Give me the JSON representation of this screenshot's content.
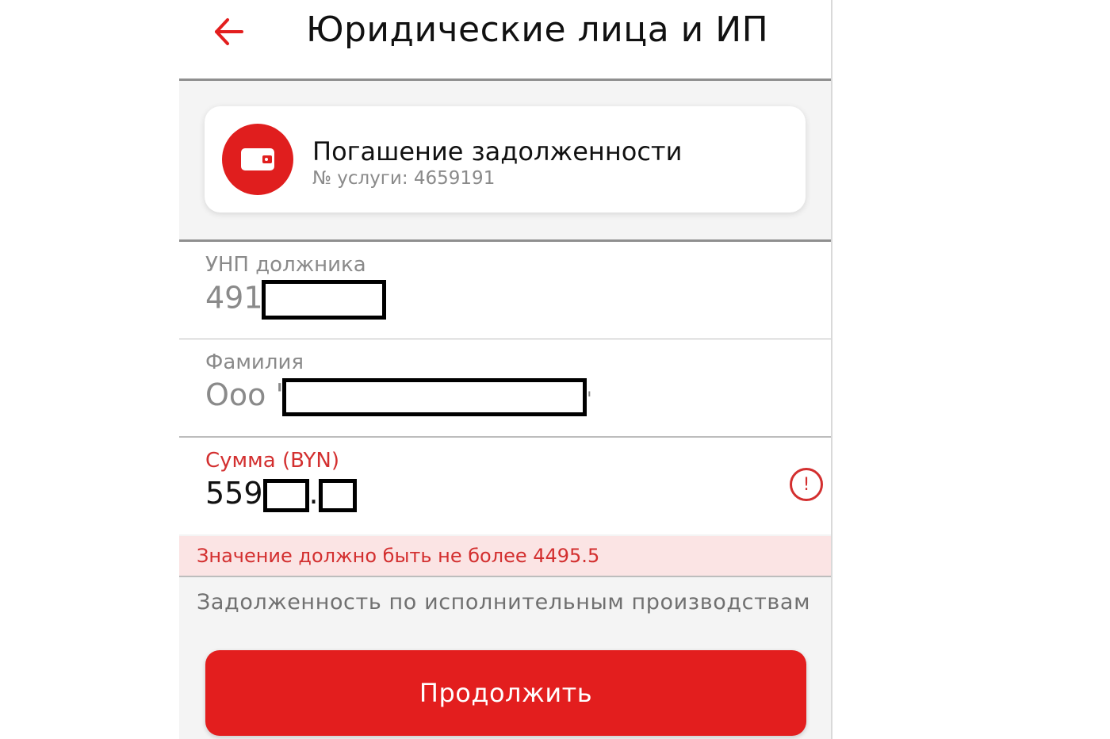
{
  "header": {
    "title": "Юридические лица и ИП",
    "back_icon": "arrow-left-icon"
  },
  "service": {
    "icon": "wallet-icon",
    "title": "Погашение задолженности",
    "subtitle": "№ услуги: 4659191"
  },
  "fields": {
    "unp": {
      "label": "УНП должника",
      "value_prefix": "491"
    },
    "surname": {
      "label": "Фамилия",
      "value_prefix": "Ооо '",
      "value_suffix": "'"
    },
    "amount": {
      "label": "Сумма (BYN)",
      "value_prefix": "559",
      "value_middle": ".",
      "alert_icon": "exclamation-circle-icon"
    }
  },
  "error": {
    "message": "Значение должно быть не более 4495.5"
  },
  "description": "Задолженность по исполнительным производствам",
  "buttons": {
    "continue_label": "Продолжить"
  },
  "colors": {
    "accent": "#e31e1e",
    "error": "#d32f2f",
    "error_bg": "#fbe4e4"
  }
}
